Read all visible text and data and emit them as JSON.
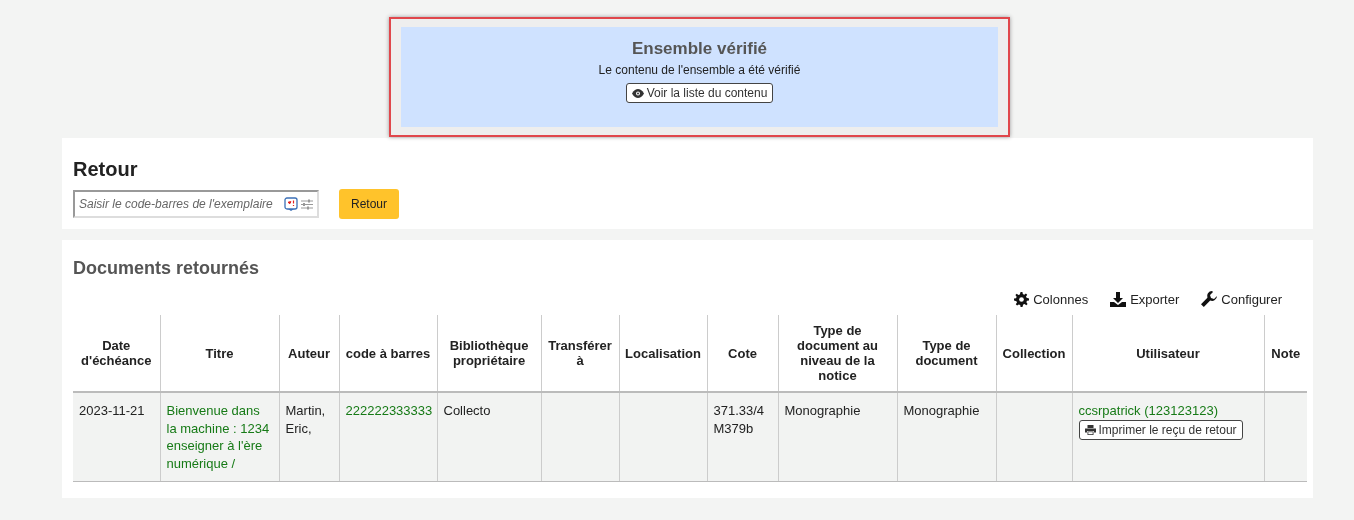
{
  "alert": {
    "title": "Ensemble vérifié",
    "message": "Le contenu de l'ensemble a été vérifié",
    "button": "Voir la liste du contenu"
  },
  "checkin": {
    "title": "Retour",
    "placeholder": "Saisir le code-barres de l'exemplaire",
    "button": "Retour"
  },
  "returned": {
    "title": "Documents retournés",
    "toolbar": [
      {
        "kind": "columns",
        "label": "Colonnes"
      },
      {
        "kind": "export",
        "label": "Exporter"
      },
      {
        "kind": "configure",
        "label": "Configurer"
      }
    ],
    "table": {
      "columns": [
        "Date d'échéance",
        "Titre",
        "Auteur",
        "code à barres",
        "Bibliothèque propriétaire",
        "Transférer à",
        "Localisation",
        "Cote",
        "Type de document au niveau de la notice",
        "Type de document",
        "Collection",
        "Utilisateur",
        "Note"
      ],
      "rows": [
        [
          {
            "kind": "text",
            "text": "2023-11-21"
          },
          {
            "kind": "link",
            "text": "Bienvenue dans la machine : 1234 enseigner à l'ère numérique /"
          },
          {
            "kind": "text",
            "text": "Martin, Eric,"
          },
          {
            "kind": "link",
            "text": "222222333333"
          },
          {
            "kind": "text",
            "text": "Collecto"
          },
          {
            "kind": "empty"
          },
          {
            "kind": "empty"
          },
          {
            "kind": "text",
            "text": "371.33/4 M379b"
          },
          {
            "kind": "text",
            "text": "Monographie"
          },
          {
            "kind": "text",
            "text": "Monographie"
          },
          {
            "kind": "empty"
          },
          {
            "kind": "patron",
            "text": "ccsrpatrick (123123123)",
            "button": "Imprimer le reçu de retour"
          },
          {
            "kind": "empty"
          }
        ]
      ]
    }
  }
}
